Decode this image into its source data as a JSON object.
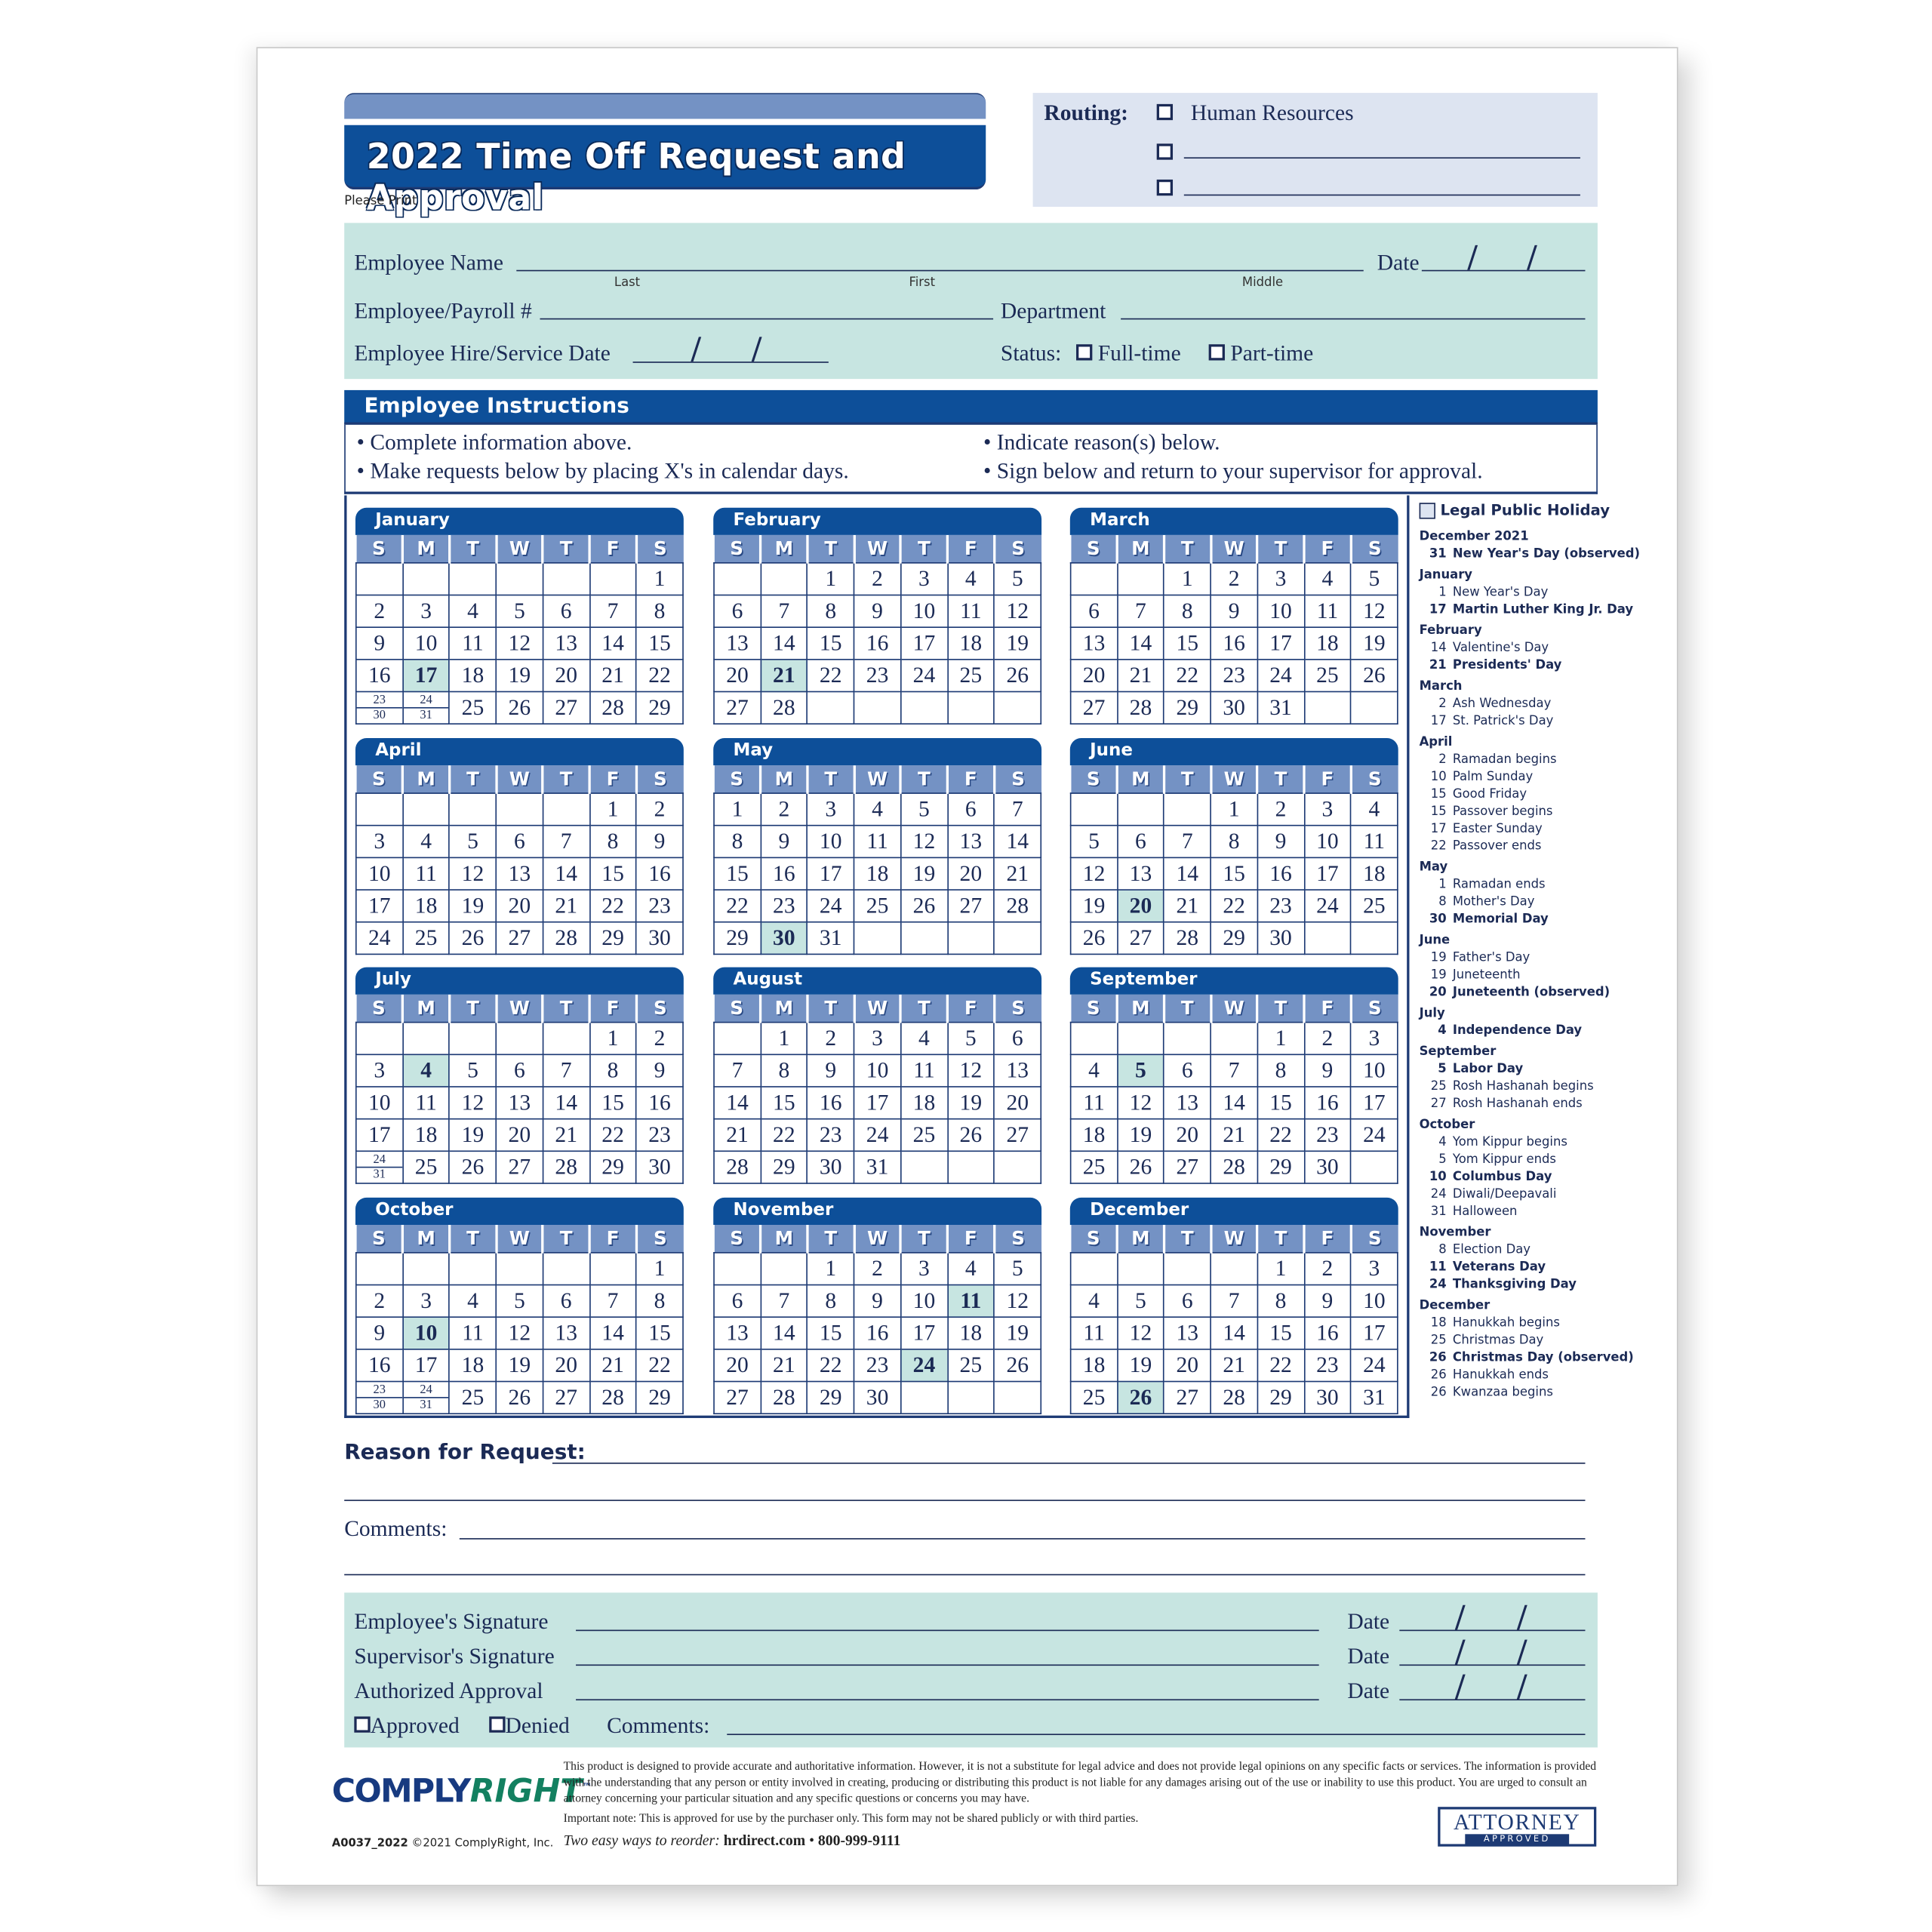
{
  "header": {
    "title": "2022 Time Off Request and Approval",
    "please_print": "Please Print"
  },
  "routing": {
    "label": "Routing:",
    "options": [
      "Human Resources",
      "",
      ""
    ]
  },
  "employee_info": {
    "name_label": "Employee Name",
    "name_sublabels": [
      "Last",
      "First",
      "Middle"
    ],
    "date_label": "Date",
    "payroll_label": "Employee/Payroll #",
    "department_label": "Department",
    "hire_date_label": "Employee Hire/Service Date",
    "status_label": "Status:",
    "status_options": [
      "Full-time",
      "Part-time"
    ]
  },
  "instructions": {
    "title": "Employee Instructions",
    "bullets": [
      "Complete information above.",
      "Make requests below by placing X's in calendar days.",
      "Indicate reason(s) below.",
      "Sign below and return to your supervisor for approval."
    ]
  },
  "weekdays": [
    "S",
    "M",
    "T",
    "W",
    "T",
    "F",
    "S"
  ],
  "calendar": {
    "year": "2022",
    "months": [
      {
        "name": "January",
        "weeks": [
          [
            "",
            "",
            "",
            "",
            "",
            "",
            "1"
          ],
          [
            "2",
            "3",
            "4",
            "5",
            "6",
            "7",
            "8"
          ],
          [
            "9",
            "10",
            "11",
            "12",
            "13",
            "14",
            "15"
          ],
          [
            "16",
            "17",
            "18",
            "19",
            "20",
            "21",
            "22"
          ],
          [
            "23/30",
            "24/31",
            "25",
            "26",
            "27",
            "28",
            "29"
          ]
        ],
        "highlight": [
          "17"
        ]
      },
      {
        "name": "February",
        "weeks": [
          [
            "",
            "",
            "1",
            "2",
            "3",
            "4",
            "5"
          ],
          [
            "6",
            "7",
            "8",
            "9",
            "10",
            "11",
            "12"
          ],
          [
            "13",
            "14",
            "15",
            "16",
            "17",
            "18",
            "19"
          ],
          [
            "20",
            "21",
            "22",
            "23",
            "24",
            "25",
            "26"
          ],
          [
            "27",
            "28",
            "",
            "",
            "",
            "",
            ""
          ]
        ],
        "highlight": [
          "21"
        ]
      },
      {
        "name": "March",
        "weeks": [
          [
            "",
            "",
            "1",
            "2",
            "3",
            "4",
            "5"
          ],
          [
            "6",
            "7",
            "8",
            "9",
            "10",
            "11",
            "12"
          ],
          [
            "13",
            "14",
            "15",
            "16",
            "17",
            "18",
            "19"
          ],
          [
            "20",
            "21",
            "22",
            "23",
            "24",
            "25",
            "26"
          ],
          [
            "27",
            "28",
            "29",
            "30",
            "31",
            "",
            ""
          ]
        ],
        "highlight": []
      },
      {
        "name": "April",
        "weeks": [
          [
            "",
            "",
            "",
            "",
            "",
            "1",
            "2"
          ],
          [
            "3",
            "4",
            "5",
            "6",
            "7",
            "8",
            "9"
          ],
          [
            "10",
            "11",
            "12",
            "13",
            "14",
            "15",
            "16"
          ],
          [
            "17",
            "18",
            "19",
            "20",
            "21",
            "22",
            "23"
          ],
          [
            "24",
            "25",
            "26",
            "27",
            "28",
            "29",
            "30"
          ]
        ],
        "highlight": []
      },
      {
        "name": "May",
        "weeks": [
          [
            "1",
            "2",
            "3",
            "4",
            "5",
            "6",
            "7"
          ],
          [
            "8",
            "9",
            "10",
            "11",
            "12",
            "13",
            "14"
          ],
          [
            "15",
            "16",
            "17",
            "18",
            "19",
            "20",
            "21"
          ],
          [
            "22",
            "23",
            "24",
            "25",
            "26",
            "27",
            "28"
          ],
          [
            "29",
            "30",
            "31",
            "",
            "",
            "",
            ""
          ]
        ],
        "highlight": [
          "30"
        ]
      },
      {
        "name": "June",
        "weeks": [
          [
            "",
            "",
            "",
            "1",
            "2",
            "3",
            "4"
          ],
          [
            "5",
            "6",
            "7",
            "8",
            "9",
            "10",
            "11"
          ],
          [
            "12",
            "13",
            "14",
            "15",
            "16",
            "17",
            "18"
          ],
          [
            "19",
            "20",
            "21",
            "22",
            "23",
            "24",
            "25"
          ],
          [
            "26",
            "27",
            "28",
            "29",
            "30",
            "",
            ""
          ]
        ],
        "highlight": [
          "20"
        ]
      },
      {
        "name": "July",
        "weeks": [
          [
            "",
            "",
            "",
            "",
            "",
            "1",
            "2"
          ],
          [
            "3",
            "4",
            "5",
            "6",
            "7",
            "8",
            "9"
          ],
          [
            "10",
            "11",
            "12",
            "13",
            "14",
            "15",
            "16"
          ],
          [
            "17",
            "18",
            "19",
            "20",
            "21",
            "22",
            "23"
          ],
          [
            "24/31",
            "25",
            "26",
            "27",
            "28",
            "29",
            "30"
          ]
        ],
        "highlight": [
          "4"
        ]
      },
      {
        "name": "August",
        "weeks": [
          [
            "",
            "1",
            "2",
            "3",
            "4",
            "5",
            "6"
          ],
          [
            "7",
            "8",
            "9",
            "10",
            "11",
            "12",
            "13"
          ],
          [
            "14",
            "15",
            "16",
            "17",
            "18",
            "19",
            "20"
          ],
          [
            "21",
            "22",
            "23",
            "24",
            "25",
            "26",
            "27"
          ],
          [
            "28",
            "29",
            "30",
            "31",
            "",
            "",
            ""
          ]
        ],
        "highlight": []
      },
      {
        "name": "September",
        "weeks": [
          [
            "",
            "",
            "",
            "",
            "1",
            "2",
            "3"
          ],
          [
            "4",
            "5",
            "6",
            "7",
            "8",
            "9",
            "10"
          ],
          [
            "11",
            "12",
            "13",
            "14",
            "15",
            "16",
            "17"
          ],
          [
            "18",
            "19",
            "20",
            "21",
            "22",
            "23",
            "24"
          ],
          [
            "25",
            "26",
            "27",
            "28",
            "29",
            "30",
            ""
          ]
        ],
        "highlight": [
          "5"
        ]
      },
      {
        "name": "October",
        "weeks": [
          [
            "",
            "",
            "",
            "",
            "",
            "",
            "1"
          ],
          [
            "2",
            "3",
            "4",
            "5",
            "6",
            "7",
            "8"
          ],
          [
            "9",
            "10",
            "11",
            "12",
            "13",
            "14",
            "15"
          ],
          [
            "16",
            "17",
            "18",
            "19",
            "20",
            "21",
            "22"
          ],
          [
            "23/30",
            "24/31",
            "25",
            "26",
            "27",
            "28",
            "29"
          ]
        ],
        "highlight": [
          "10"
        ]
      },
      {
        "name": "November",
        "weeks": [
          [
            "",
            "",
            "1",
            "2",
            "3",
            "4",
            "5"
          ],
          [
            "6",
            "7",
            "8",
            "9",
            "10",
            "11",
            "12"
          ],
          [
            "13",
            "14",
            "15",
            "16",
            "17",
            "18",
            "19"
          ],
          [
            "20",
            "21",
            "22",
            "23",
            "24",
            "25",
            "26"
          ],
          [
            "27",
            "28",
            "29",
            "30",
            "",
            "",
            ""
          ]
        ],
        "highlight": [
          "11",
          "24"
        ]
      },
      {
        "name": "December",
        "weeks": [
          [
            "",
            "",
            "",
            "",
            "1",
            "2",
            "3"
          ],
          [
            "4",
            "5",
            "6",
            "7",
            "8",
            "9",
            "10"
          ],
          [
            "11",
            "12",
            "13",
            "14",
            "15",
            "16",
            "17"
          ],
          [
            "18",
            "19",
            "20",
            "21",
            "22",
            "23",
            "24"
          ],
          [
            "25",
            "26",
            "27",
            "28",
            "29",
            "30",
            "31"
          ]
        ],
        "highlight": [
          "26"
        ]
      }
    ]
  },
  "holidays": {
    "legend": "Legal Public Holiday",
    "groups": [
      {
        "month": "December 2021",
        "items": [
          {
            "day": "31",
            "name": "New Year's Day (observed)",
            "legal": true
          }
        ]
      },
      {
        "month": "January",
        "items": [
          {
            "day": "1",
            "name": "New Year's Day",
            "legal": false
          },
          {
            "day": "17",
            "name": "Martin Luther King Jr. Day",
            "legal": true
          }
        ]
      },
      {
        "month": "February",
        "items": [
          {
            "day": "14",
            "name": "Valentine's Day",
            "legal": false
          },
          {
            "day": "21",
            "name": "Presidents' Day",
            "legal": true
          }
        ]
      },
      {
        "month": "March",
        "items": [
          {
            "day": "2",
            "name": "Ash Wednesday",
            "legal": false
          },
          {
            "day": "17",
            "name": "St. Patrick's Day",
            "legal": false
          }
        ]
      },
      {
        "month": "April",
        "items": [
          {
            "day": "2",
            "name": "Ramadan begins",
            "legal": false
          },
          {
            "day": "10",
            "name": "Palm Sunday",
            "legal": false
          },
          {
            "day": "15",
            "name": "Good Friday",
            "legal": false
          },
          {
            "day": "15",
            "name": "Passover begins",
            "legal": false
          },
          {
            "day": "17",
            "name": "Easter Sunday",
            "legal": false
          },
          {
            "day": "22",
            "name": "Passover ends",
            "legal": false
          }
        ]
      },
      {
        "month": "May",
        "items": [
          {
            "day": "1",
            "name": "Ramadan ends",
            "legal": false
          },
          {
            "day": "8",
            "name": "Mother's Day",
            "legal": false
          },
          {
            "day": "30",
            "name": "Memorial Day",
            "legal": true
          }
        ]
      },
      {
        "month": "June",
        "items": [
          {
            "day": "19",
            "name": "Father's Day",
            "legal": false
          },
          {
            "day": "19",
            "name": "Juneteenth",
            "legal": false
          },
          {
            "day": "20",
            "name": "Juneteenth (observed)",
            "legal": true
          }
        ]
      },
      {
        "month": "July",
        "items": [
          {
            "day": "4",
            "name": "Independence Day",
            "legal": true
          }
        ]
      },
      {
        "month": "September",
        "items": [
          {
            "day": "5",
            "name": "Labor Day",
            "legal": true
          },
          {
            "day": "25",
            "name": "Rosh Hashanah begins",
            "legal": false
          },
          {
            "day": "27",
            "name": "Rosh Hashanah ends",
            "legal": false
          }
        ]
      },
      {
        "month": "October",
        "items": [
          {
            "day": "4",
            "name": "Yom Kippur begins",
            "legal": false
          },
          {
            "day": "5",
            "name": "Yom Kippur ends",
            "legal": false
          },
          {
            "day": "10",
            "name": "Columbus Day",
            "legal": true
          },
          {
            "day": "24",
            "name": "Diwali/Deepavali",
            "legal": false
          },
          {
            "day": "31",
            "name": "Halloween",
            "legal": false
          }
        ]
      },
      {
        "month": "November",
        "items": [
          {
            "day": "8",
            "name": "Election Day",
            "legal": false
          },
          {
            "day": "11",
            "name": "Veterans Day",
            "legal": true
          },
          {
            "day": "24",
            "name": "Thanksgiving Day",
            "legal": true
          }
        ]
      },
      {
        "month": "December",
        "items": [
          {
            "day": "18",
            "name": "Hanukkah begins",
            "legal": false
          },
          {
            "day": "25",
            "name": "Christmas Day",
            "legal": false
          },
          {
            "day": "26",
            "name": "Christmas Day (observed)",
            "legal": true
          },
          {
            "day": "26",
            "name": "Hanukkah ends",
            "legal": false
          },
          {
            "day": "26",
            "name": "Kwanzaa begins",
            "legal": false
          }
        ]
      }
    ]
  },
  "reason": {
    "reason_label": "Reason for Request:",
    "comments_label": "Comments:"
  },
  "signatures": {
    "rows": [
      {
        "label": "Employee's Signature",
        "date_label": "Date"
      },
      {
        "label": "Supervisor's Signature",
        "date_label": "Date"
      },
      {
        "label": "Authorized Approval",
        "date_label": "Date"
      }
    ],
    "approved_label": "Approved",
    "denied_label": "Denied",
    "comments_label": "Comments:"
  },
  "footer": {
    "logo_part1": "COMPLY",
    "logo_part2": "RIGHT",
    "logo_tm": "™",
    "code": "A0037_2022",
    "copyright": "©2021 ComplyRight, Inc.",
    "disclaimer": "This product is designed to provide accurate and authoritative information. However, it is not a substitute for legal advice and does not provide legal opinions on any specific facts or services. The information is provided with the understanding that any person or entity involved in creating, producing or distributing this product is not liable for any damages arising out of the use or inability to use this product. You are urged to consult an attorney concerning your particular situation and any specific questions or concerns you may have.",
    "important_note": "Important note: This is approved for use by the purchaser only. This form may not be shared publicly or with third parties.",
    "reorder_lead": "Two easy ways to reorder:",
    "reorder_site": "hrdirect.com",
    "reorder_sep": "•",
    "reorder_phone": "800-999-9111",
    "badge_top": "ATTORNEY",
    "badge_bottom": "APPROVED"
  },
  "colors": {
    "navy": "#1d3a74",
    "header_blue": "#0d4f99",
    "weekday_blue": "#7492c4",
    "mint": "#c7e5e1",
    "lavender": "#dde4f1",
    "logo_green": "#138060"
  }
}
